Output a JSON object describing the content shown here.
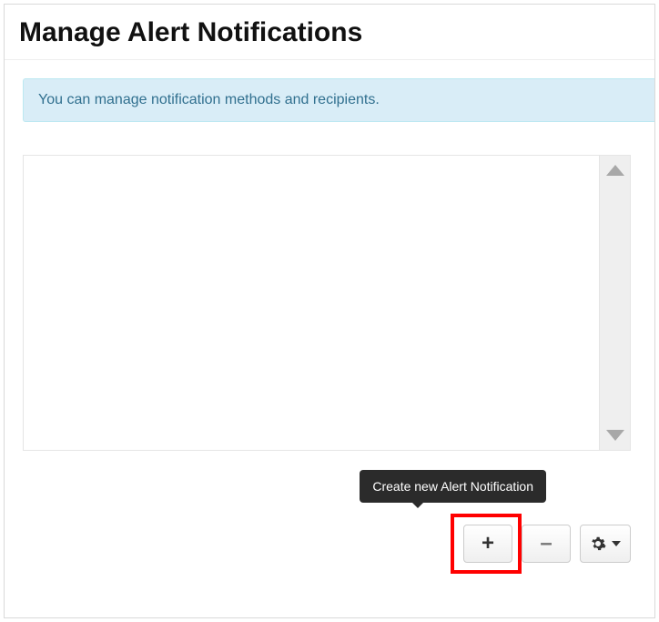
{
  "header": {
    "title": "Manage Alert Notifications"
  },
  "info": {
    "text": "You can manage notification methods and recipients."
  },
  "tooltip": {
    "text": "Create new Alert Notification"
  },
  "buttons": {
    "add": "+",
    "remove": "–"
  }
}
